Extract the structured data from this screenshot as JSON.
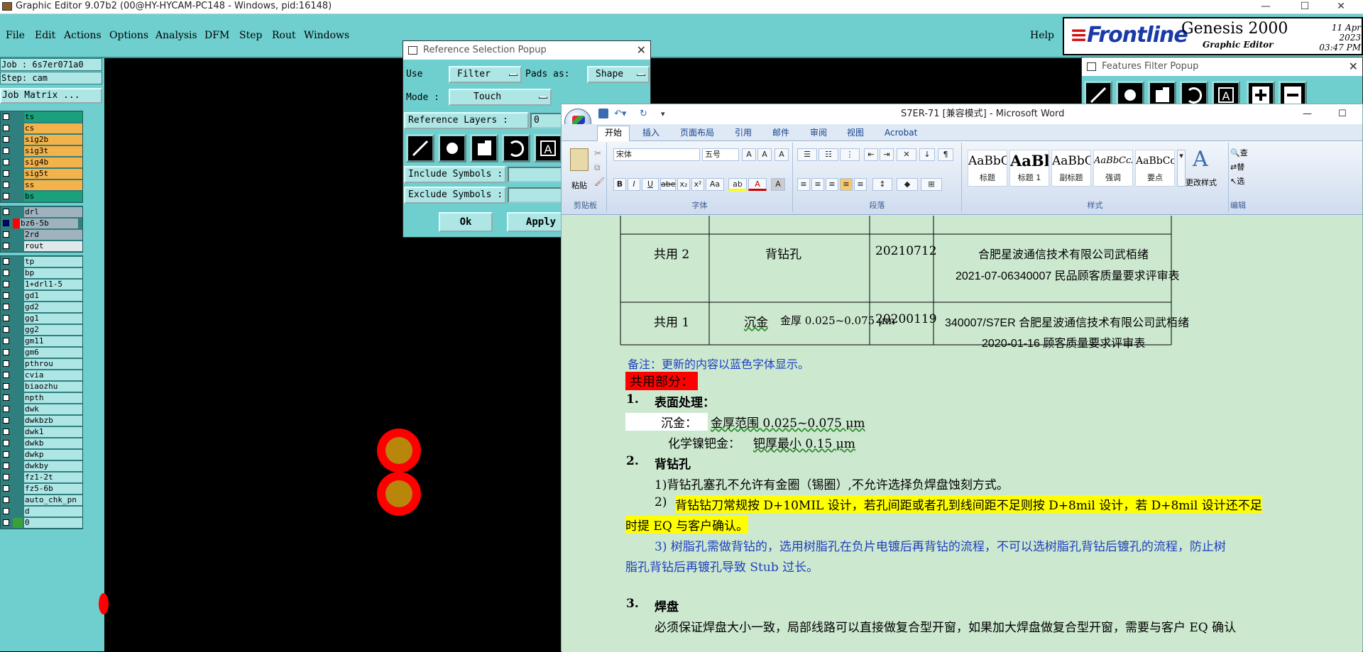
{
  "genesis": {
    "window_title": "Graphic Editor 9.07b2 (00@HY-HYCAM-PC148 - Windows, pid:16148)",
    "window_controls": {
      "minimize": "—",
      "maximize": "☐",
      "close": "✕"
    },
    "menu": [
      "File",
      "Edit",
      "Actions",
      "Options",
      "Analysis",
      "DFM",
      "Step",
      "Rout",
      "Windows"
    ],
    "help": "Help",
    "brand": {
      "logo": "Frontline",
      "product": "Genesis 2000",
      "subtitle": "Graphic Editor",
      "date": "11 Apr 2023",
      "time": "03:47 PM"
    },
    "job_line": "Job : 6s7er071a0",
    "step_line": "Step: cam",
    "job_matrix": "Job Matrix ...",
    "layer_groups": [
      {
        "layers": [
          {
            "name": "ts",
            "color": "#1aa07a"
          },
          {
            "name": "cs",
            "color": "#f4b24a"
          },
          {
            "name": "sig2b",
            "color": "#f4b24a"
          },
          {
            "name": "sig3t",
            "color": "#f4b24a"
          },
          {
            "name": "sig4b",
            "color": "#f4b24a"
          },
          {
            "name": "sig5t",
            "color": "#f4b24a"
          },
          {
            "name": "ss",
            "color": "#f4b24a"
          },
          {
            "name": "bs",
            "color": "#1aa07a"
          }
        ]
      },
      {
        "layers": [
          {
            "name": "drl",
            "color": "#9fb3bf"
          },
          {
            "name": "bz6-5b",
            "color": "#9fb3bf",
            "active": true
          },
          {
            "name": "2rd",
            "color": "#9fb3bf"
          },
          {
            "name": "rout",
            "color": "#dfe9ea"
          }
        ]
      },
      {
        "layers": [
          {
            "name": "tp"
          },
          {
            "name": "bp"
          },
          {
            "name": "1+drl1-5"
          },
          {
            "name": "gd1"
          },
          {
            "name": "gd2"
          },
          {
            "name": "gg1"
          },
          {
            "name": "gg2"
          },
          {
            "name": "gm11"
          },
          {
            "name": "gm6"
          },
          {
            "name": "pthrou"
          },
          {
            "name": "cvia"
          },
          {
            "name": "biaozhu"
          },
          {
            "name": "npth"
          },
          {
            "name": "dwk"
          },
          {
            "name": "dwkbzb"
          },
          {
            "name": "dwk1"
          },
          {
            "name": "dwkb"
          },
          {
            "name": "dwkp"
          },
          {
            "name": "dwkby"
          },
          {
            "name": "fz1-2t"
          },
          {
            "name": "fz5-6b"
          },
          {
            "name": "auto_chk_pn"
          },
          {
            "name": "d"
          },
          {
            "name": "0",
            "swatch": "#3aa03a"
          }
        ]
      }
    ],
    "colors": {
      "panel": "#6fcfcf",
      "pad_ring": "#ff0000",
      "pad_core": "#b8860b"
    }
  },
  "ref_popup": {
    "title": "Reference Selection Popup",
    "close": "✕",
    "use_label": "Use",
    "use_value": "Filter",
    "pads_as_label": "Pads as:",
    "pads_as_value": "Shape",
    "mode_label": "Mode :",
    "mode_value": "Touch",
    "reference_layers_label": "Reference Layers :",
    "reference_layers_value": "0",
    "include_symbols_label": "Include Symbols :",
    "exclude_symbols_label": "Exclude Symbols :",
    "ok": "Ok",
    "apply": "Apply"
  },
  "feat_popup": {
    "title": "Features Filter Popup",
    "close": "✕"
  },
  "word": {
    "title": "S7ER-71 [兼容模式] - Microsoft Word",
    "qat": {
      "undo_arrow": "▾",
      "customize": "▾"
    },
    "window_controls": {
      "minimize": "—",
      "maximize": "☐"
    },
    "tabs": [
      "开始",
      "插入",
      "页面布局",
      "引用",
      "邮件",
      "审阅",
      "视图",
      "Acrobat"
    ],
    "groups": {
      "clipboard": "剪贴板",
      "paste": "粘贴",
      "font": "字体",
      "paragraph": "段落",
      "styles": "样式",
      "editing": "编辑",
      "font_name": "宋体",
      "font_size": "五号",
      "change_styles": "更改样式",
      "find": "查",
      "replace": "替",
      "select": "选"
    },
    "font_buttons": [
      "B",
      "I",
      "U",
      "abe",
      "x₂",
      "x²",
      "Aa"
    ],
    "styles": [
      {
        "sample": "AaBbC",
        "name": "标题"
      },
      {
        "sample": "AaBl",
        "name": "标题 1"
      },
      {
        "sample": "AaBbC",
        "name": "副标题"
      },
      {
        "sample": "AaBbCcDd",
        "name": "强调"
      },
      {
        "sample": "AaBbCcD",
        "name": "要点"
      }
    ],
    "doc": {
      "row2": {
        "c1": "共用 2",
        "c2": "背钻孔",
        "c3": "20210712",
        "c4a": "合肥星波通信技术有限公司武栢绪",
        "c4b": "2021-07-06340007 民品顾客质量要求评审表"
      },
      "row1": {
        "c1": "共用 1",
        "c2a": "沉金",
        "c2b": "金厚 0.025~0.075 μm",
        "c3": "20200119",
        "c4a": "340007/S7ER 合肥星波通信技术有限公司武栢绪",
        "c4b": "2020-01-16 顾客质量要求评审表"
      },
      "note": "备注：更新的内容以蓝色字体显示。",
      "common_part": "共用部分：",
      "s1_num": "1.",
      "s1_title": "表面处理：",
      "s1_line1_a": "沉金：",
      "s1_line1_b": "金厚范围 0.025~0.075 μm",
      "s1_line2_a": "化学镍钯金：",
      "s1_line2_b": "钯厚最小 0.15 μm",
      "s2_num": "2.",
      "s2_title": "背钻孔",
      "s2_p1": "1)背钻孔塞孔不允许有金圈（锡圈）,不允许选择负焊盘蚀刻方式。",
      "s2_p2_num": "2)",
      "s2_p2_a": "背钻钻刀常规按 D+10MIL 设计，若孔间距或者孔到线间距不足则按 D+8mil 设计，若 D+8mil 设计还不足",
      "s2_p2_b": "时提 EQ 与客户确认。",
      "s2_p3_a": "3) 树脂孔需做背钻的，选用树脂孔在负片电镀后再背钻的流程，不可以选树脂孔背钻后镀孔的流程，防止树",
      "s2_p3_b": "脂孔背钻后再镀孔导致 Stub 过长。",
      "s3_num": "3.",
      "s3_title": "焊盘",
      "s3_p1": "必须保证焊盘大小一致，局部线路可以直接做复合型开窗，如果加大焊盘做复合型开窗，需要与客户 EQ 确认"
    }
  }
}
